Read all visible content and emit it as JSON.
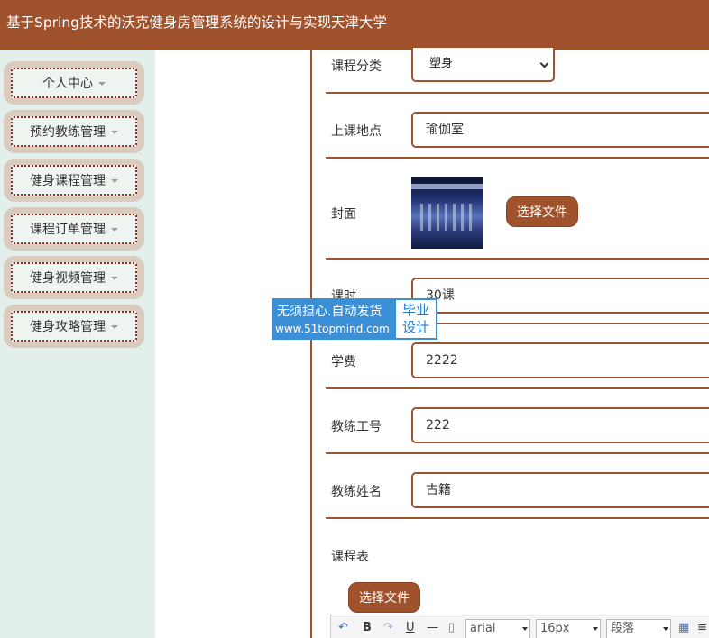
{
  "header": {
    "title": "基于Spring技术的沃克健身房管理系统的设计与实现天津大学"
  },
  "sidebar": {
    "items": [
      {
        "label": "个人中心"
      },
      {
        "label": "预约教练管理"
      },
      {
        "label": "健身课程管理"
      },
      {
        "label": "课程订单管理"
      },
      {
        "label": "健身视频管理"
      },
      {
        "label": "健身攻略管理"
      }
    ]
  },
  "form": {
    "category": {
      "label": "课程分类",
      "value": "塑身"
    },
    "location": {
      "label": "上课地点",
      "value": "瑜伽室"
    },
    "cover": {
      "label": "封面",
      "button": "选择文件"
    },
    "hours": {
      "label": "课时",
      "value": "30课"
    },
    "fee": {
      "label": "学费",
      "value": "2222"
    },
    "coach_id": {
      "label": "教练工号",
      "value": "222"
    },
    "coach_name": {
      "label": "教练姓名",
      "value": "古籍"
    },
    "schedule": {
      "label": "课程表",
      "button": "选择文件"
    }
  },
  "watermark": {
    "line1": "无须担心.自动发货",
    "line2": "www.51topmind.com",
    "badge1": "毕业",
    "badge2": "设计"
  },
  "editor": {
    "undo_icon": "undo-icon",
    "bold": "B",
    "underline": "U",
    "font_family": "arial",
    "font_size": "16px",
    "paragraph": "段落"
  }
}
